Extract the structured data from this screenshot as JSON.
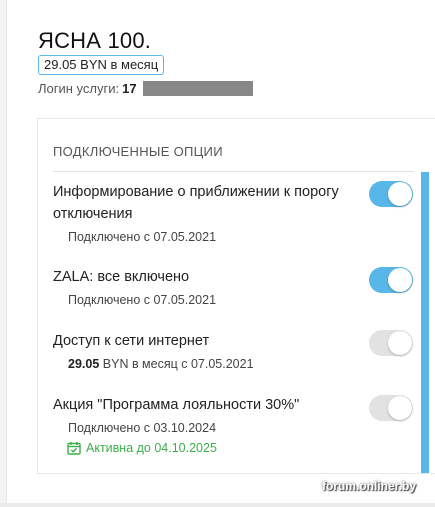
{
  "plan": {
    "title": "ЯСНА 100.",
    "price": "29.05 BYN в месяц",
    "login_label": "Логин услуги:",
    "login_value": "17"
  },
  "options_section": {
    "header": "ПОДКЛЮЧЕННЫЕ ОПЦИИ",
    "items": [
      {
        "title": "Информирование о приближении к порогу отключения",
        "subtitle": "Подключено с 07.05.2021",
        "toggle_on": true
      },
      {
        "title": "ZALA: все включено",
        "subtitle": "Подключено с 07.05.2021",
        "toggle_on": true
      },
      {
        "title": "Доступ к сети интернет",
        "subtitle_price": "29.05",
        "subtitle_rest": "BYN в месяц с 07.05.2021",
        "toggle_on": false
      },
      {
        "title": "Акция \"Программа лояльности 30%\"",
        "subtitle": "Подключено с 03.10.2024",
        "active_until": "Активна до 04.10.2025",
        "toggle_on": false
      }
    ]
  },
  "watermark": "forum.onliner.by",
  "icons": {
    "calendar": "calendar-check-icon"
  },
  "colors": {
    "accent": "#58b7e8",
    "active_green": "#3bb04a",
    "toggle_off": "#e2e2e2"
  }
}
